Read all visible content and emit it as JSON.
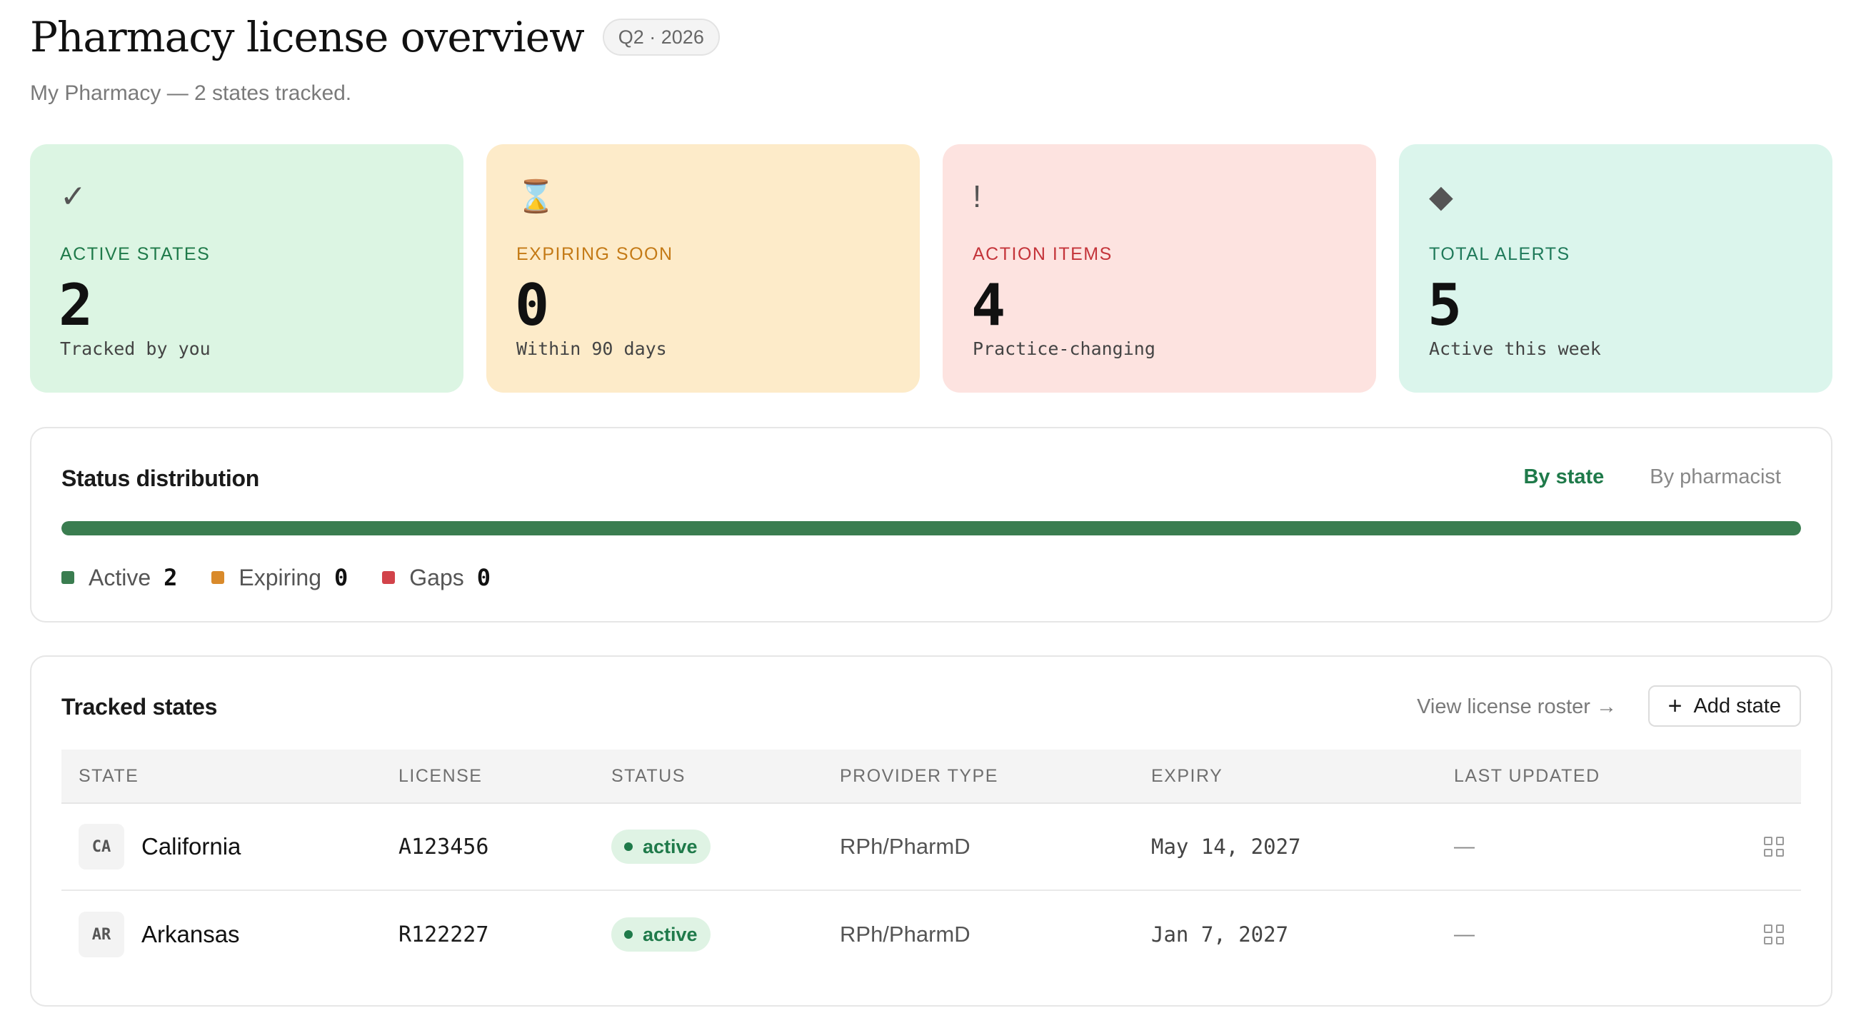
{
  "header": {
    "title": "Pharmacy license overview",
    "period": "Q2 · 2026",
    "subtitle": "My Pharmacy — 2 states tracked."
  },
  "cards": [
    {
      "icon": "check-icon",
      "glyph": "✓",
      "label": "ACTIVE STATES",
      "value": "2",
      "note": "Tracked by you",
      "bg": "#dcf5e3",
      "accent": "#1f7a4a"
    },
    {
      "icon": "hourglass-icon",
      "glyph": "⌛",
      "label": "EXPIRING SOON",
      "value": "0",
      "note": "Within 90 days",
      "bg": "#fdebc9",
      "accent": "#c47a16"
    },
    {
      "icon": "exclamation-icon",
      "glyph": "!",
      "label": "ACTION ITEMS",
      "value": "4",
      "note": "Practice-changing",
      "bg": "#fde3e0",
      "accent": "#c4343a"
    },
    {
      "icon": "diamond-icon",
      "glyph": "◆",
      "label": "TOTAL ALERTS",
      "value": "5",
      "note": "Active this week",
      "bg": "#dbf5ec",
      "accent": "#1f7a5a"
    }
  ],
  "distribution": {
    "title": "Status distribution",
    "tabs": [
      "By state",
      "By pharmacist"
    ],
    "active_fraction": 1.0,
    "legend": [
      {
        "label": "Active",
        "count": "2",
        "color": "#3a7d50"
      },
      {
        "label": "Expiring",
        "count": "0",
        "color": "#d98a2b"
      },
      {
        "label": "Gaps",
        "count": "0",
        "color": "#d2434a"
      }
    ]
  },
  "states": {
    "title": "Tracked states",
    "roster_link": "View license roster →",
    "add_label": "Add state",
    "columns": [
      "STATE",
      "LICENSE",
      "STATUS",
      "PROVIDER TYPE",
      "EXPIRY",
      "LAST UPDATED"
    ],
    "rows": [
      {
        "abbr": "CA",
        "name": "California",
        "license": "A123456",
        "status": "active",
        "provider_type": "RPh/PharmD",
        "expiry": "May 14, 2027",
        "updated": "—"
      },
      {
        "abbr": "AR",
        "name": "Arkansas",
        "license": "R122227",
        "status": "active",
        "provider_type": "RPh/PharmD",
        "expiry": "Jan 7, 2027",
        "updated": "—"
      }
    ]
  }
}
